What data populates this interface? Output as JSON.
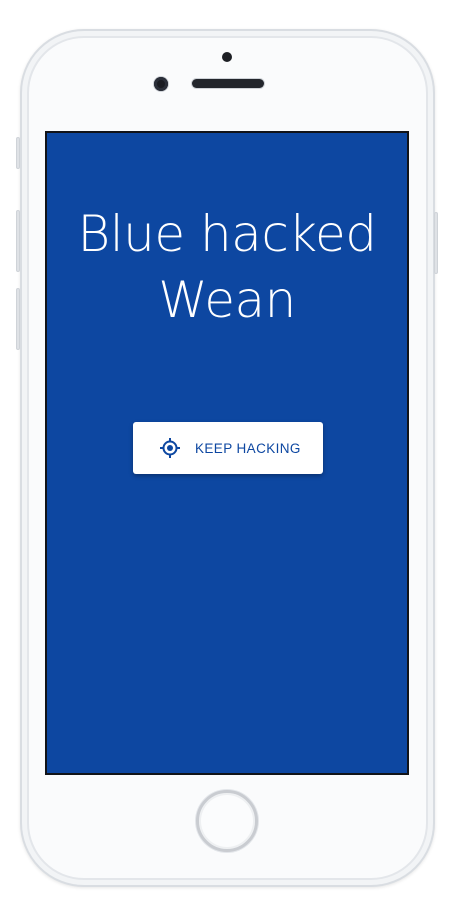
{
  "screen": {
    "background_color": "#0d47a1",
    "headline": "Blue hacked Wean"
  },
  "action_button": {
    "label": "KEEP HACKING",
    "icon": "crosshair-target-icon",
    "text_color": "#0d47a1"
  }
}
